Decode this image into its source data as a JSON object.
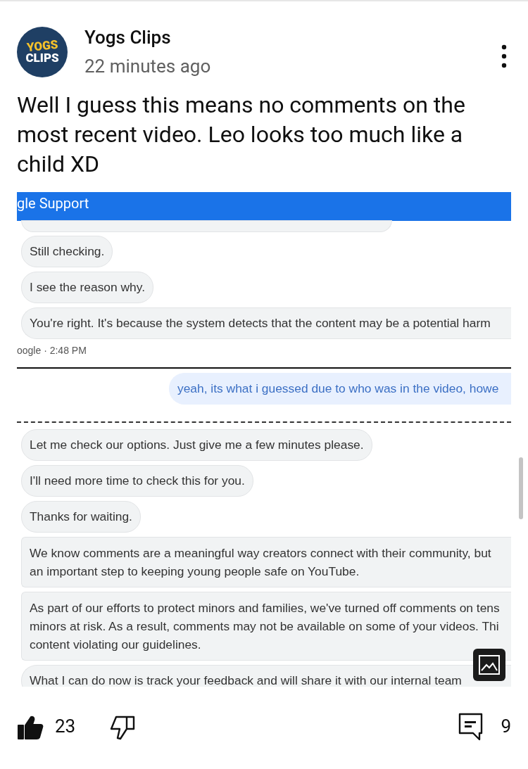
{
  "post": {
    "channel": "Yogs Clips",
    "avatar_text": [
      "YOGS",
      "CLIPS"
    ],
    "time": "22 minutes ago",
    "text": "Well I guess this means no comments on the most recent video. Leo looks too much like a child XD"
  },
  "chat": {
    "header": "gle Support",
    "items": [
      {
        "kind": "stub"
      },
      {
        "kind": "message",
        "lines": [
          "Still checking."
        ]
      },
      {
        "kind": "message",
        "lines": [
          "I see the reason why."
        ]
      },
      {
        "kind": "clipped",
        "lines": [
          "You're right. It's because the system detects that the content may be a potential harm"
        ]
      },
      {
        "kind": "meta",
        "text": "oogle · 2:48 PM"
      },
      {
        "kind": "rule"
      },
      {
        "kind": "reply",
        "lines": [
          "yeah, its what i guessed due to who was in the video, howe"
        ]
      },
      {
        "kind": "dashed"
      },
      {
        "kind": "message",
        "lines": [
          "Let me check our options. Just give me a few minutes please."
        ]
      },
      {
        "kind": "message",
        "lines": [
          "I'll need more time to check this for you."
        ]
      },
      {
        "kind": "message",
        "lines": [
          "Thanks for waiting."
        ]
      },
      {
        "kind": "clipped",
        "lines": [
          "We know comments are a meaningful way creators connect with their community, but",
          "an important step to keeping young people safe on YouTube."
        ]
      },
      {
        "kind": "clipped",
        "lines": [
          "As part of our efforts to protect minors and families, we've turned off comments on tens",
          "minors at risk. As a result, comments may not be available on some of your videos. Thi",
          "content violating our guidelines."
        ]
      },
      {
        "kind": "clipped",
        "lines": [
          "What I can do now is track your feedback and will share it with our internal team"
        ]
      }
    ]
  },
  "actions": {
    "liked": true,
    "likes": "23",
    "comments": "9"
  }
}
